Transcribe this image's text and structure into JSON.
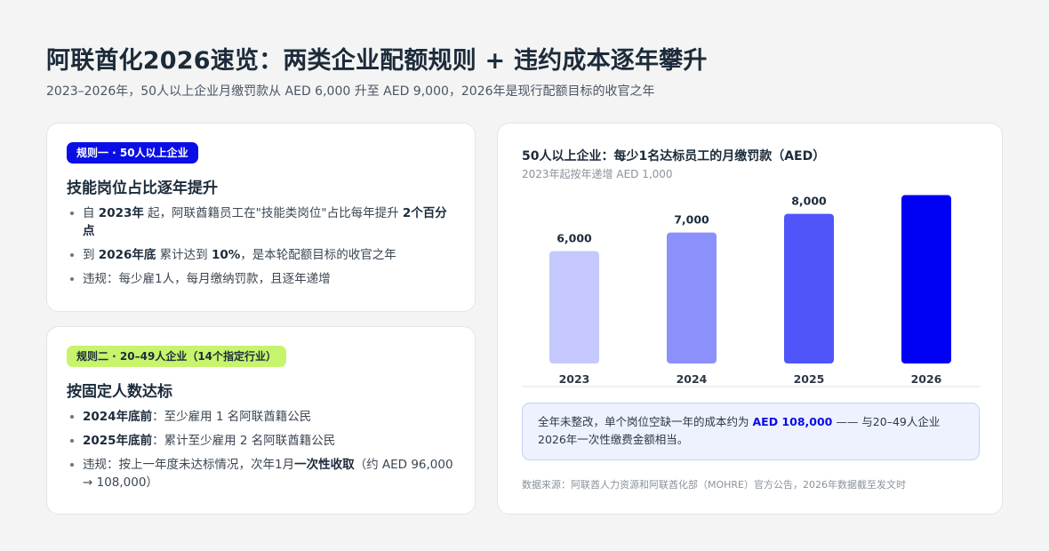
{
  "header": {
    "title": "阿联酋化2026速览：两类企业配额规则 + 违约成本逐年攀升",
    "subtitle": "2023–2026年，50人以上企业月缴罚款从 AED 6,000 升至 AED 9,000，2026年是现行配额目标的收官之年"
  },
  "rule1": {
    "badge": "规则一 · 50人以上企业",
    "heading": "技能岗位占比逐年提升",
    "items": [
      [
        {
          "t": "自 "
        },
        {
          "t": "2023年",
          "b": true
        },
        {
          "t": " 起，阿联酋籍员工在\"技能类岗位\"占比每年提升 "
        },
        {
          "t": "2个百分点",
          "b": true
        }
      ],
      [
        {
          "t": "到 "
        },
        {
          "t": "2026年底",
          "b": true
        },
        {
          "t": " 累计达到 "
        },
        {
          "t": "10%",
          "b": true
        },
        {
          "t": "，是本轮配额目标的收官之年"
        }
      ],
      [
        {
          "t": "违规：每少雇1人，每月缴纳罚款，且逐年递增"
        }
      ]
    ]
  },
  "rule2": {
    "badge": "规则二 · 20–49人企业（14个指定行业）",
    "heading": "按固定人数达标",
    "items": [
      [
        {
          "t": "2024年底前",
          "b": true
        },
        {
          "t": "：至少雇用 1 名阿联酋籍公民"
        }
      ],
      [
        {
          "t": "2025年底前",
          "b": true
        },
        {
          "t": "：累计至少雇用 2 名阿联酋籍公民"
        }
      ],
      [
        {
          "t": "违规：按上一年度未达标情况，次年1月"
        },
        {
          "t": "一次性收取",
          "b": true
        },
        {
          "t": "（约 AED 96,000 → 108,000）"
        }
      ]
    ]
  },
  "chart_data": {
    "type": "bar",
    "title": "50人以上企业：每少1名达标员工的月缴罚款（AED）",
    "subtitle": "2023年起按年递增 AED 1,000",
    "categories": [
      "2023",
      "2024",
      "2025",
      "2026"
    ],
    "values": [
      6000,
      7000,
      8000,
      9000
    ],
    "value_labels": [
      "6,000",
      "7,000",
      "8,000",
      ""
    ],
    "colors": [
      "#c5c8fc",
      "#8b90fa",
      "#4f55f8",
      "#0000f5"
    ],
    "ylim": [
      0,
      9500
    ],
    "grid": false,
    "legend": "none"
  },
  "note": {
    "text_a": "全年未整改，单个岗位空缺一年的成本约为 ",
    "highlight": "AED 108,000",
    "text_b": " —— 与20–49人企业2026年一次性缴费金额相当。"
  },
  "source": "数据来源：阿联酋人力资源和阿联酋化部（MOHRE）官方公告，2026年数据截至发文时"
}
